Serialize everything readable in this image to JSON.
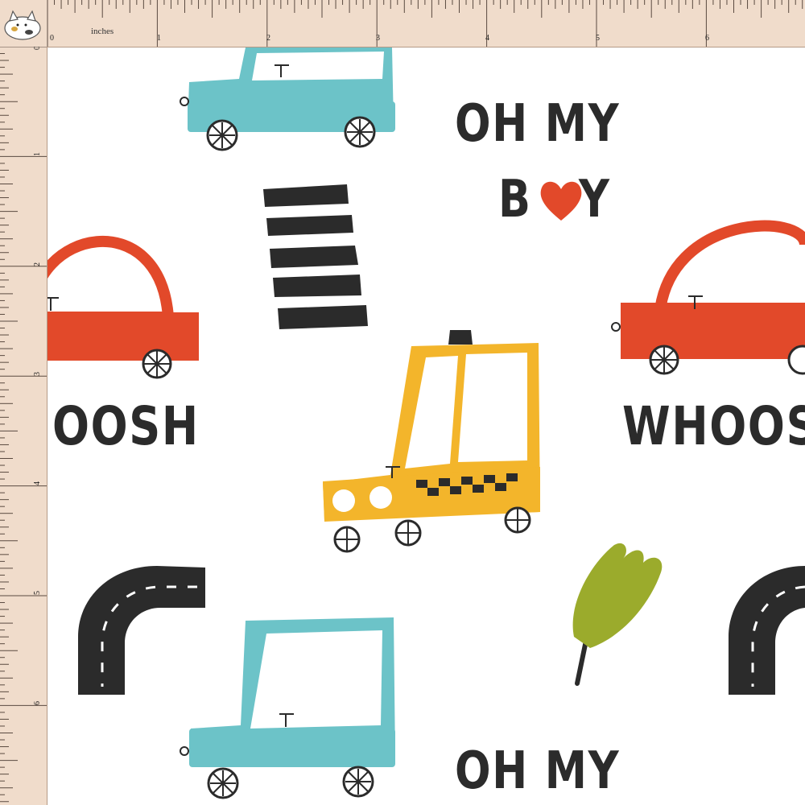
{
  "ruler": {
    "unit_label": "inches",
    "top_numbers": [
      "0",
      "1",
      "2",
      "3",
      "4",
      "5",
      "6"
    ],
    "left_numbers": [
      "0",
      "1",
      "2",
      "3",
      "4",
      "5",
      "6"
    ]
  },
  "pattern": {
    "phrase_top": "OH MY",
    "phrase_boy_b": "B",
    "phrase_boy_y": "Y",
    "whoosh_left": "OOSH",
    "whoosh_right": "WHOOS",
    "phrase_bottom": "OH MY",
    "taxi_sign": "T",
    "colors": {
      "blue_car": "#6cc3c8",
      "red_car": "#e2492a",
      "taxi": "#f3b52b",
      "road": "#2b2b2b",
      "tree": "#9bab2c",
      "heart": "#e2492a"
    }
  }
}
